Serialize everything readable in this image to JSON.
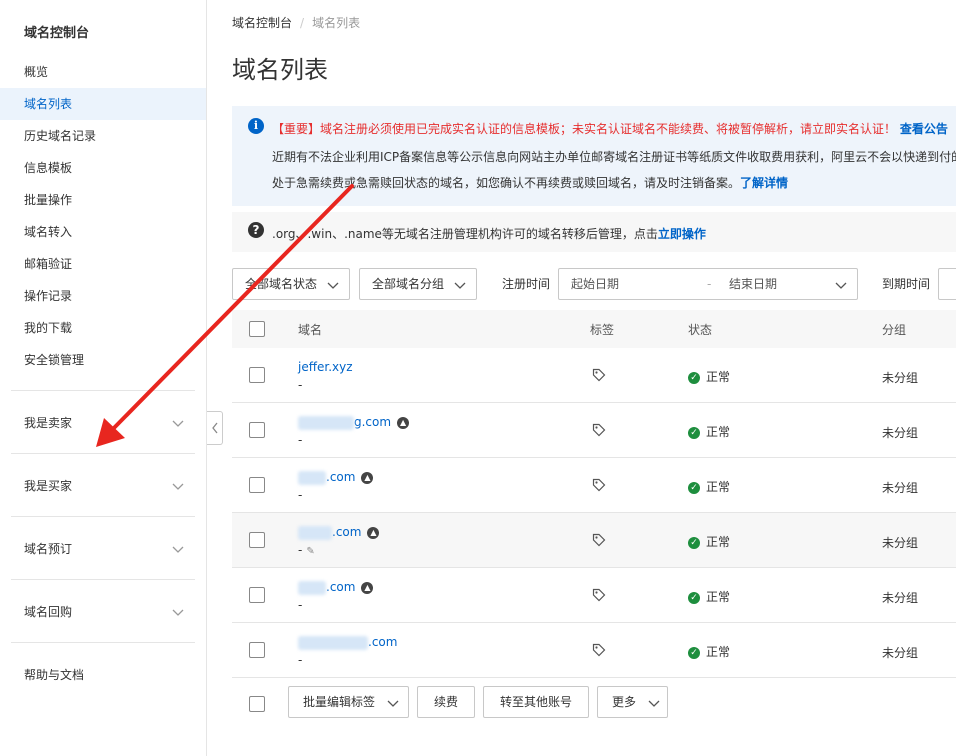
{
  "sidebar": {
    "title": "域名控制台",
    "items": [
      {
        "label": "概览",
        "active": false
      },
      {
        "label": "域名列表",
        "active": true
      },
      {
        "label": "历史域名记录",
        "active": false
      },
      {
        "label": "信息模板",
        "active": false
      },
      {
        "label": "批量操作",
        "active": false
      },
      {
        "label": "域名转入",
        "active": false
      },
      {
        "label": "邮箱验证",
        "active": false
      },
      {
        "label": "操作记录",
        "active": false
      },
      {
        "label": "我的下载",
        "active": false
      },
      {
        "label": "安全锁管理",
        "active": false
      }
    ],
    "groups": [
      {
        "label": "我是卖家"
      },
      {
        "label": "我是买家"
      },
      {
        "label": "域名预订"
      },
      {
        "label": "域名回购"
      }
    ],
    "help": "帮助与文档"
  },
  "breadcrumb": {
    "root": "域名控制台",
    "sep": "/",
    "current": "域名列表"
  },
  "page_title": "域名列表",
  "notice": {
    "important": "【重要】域名注册必须使用已完成实名认证的信息模板；未实名认证域名不能续费、将被暂停解析，请立即实名认证！",
    "important_link": "查看公告",
    "line2": "近期有不法企业利用ICP备案信息等公示信息向网站主办单位邮寄域名注册证书等纸质文件收取费用获利，阿里云不会以快递到付的",
    "line3": "处于急需续费或急需赎回状态的域名，如您确认不再续费或赎回域名，请及时注销备案。",
    "line3_link": "了解详情"
  },
  "tip": {
    "text": ".org、.win、.name等无域名注册管理机构许可的域名转移后管理，点击",
    "link": "立即操作"
  },
  "filters": {
    "status": "全部域名状态",
    "group": "全部域名分组",
    "reg_time_label": "注册时间",
    "start_placeholder": "起始日期",
    "range_sep": "-",
    "end_placeholder": "结束日期",
    "expire_label": "到期时间"
  },
  "table": {
    "headers": {
      "domain": "域名",
      "tag": "标签",
      "status": "状态",
      "group": "分组"
    },
    "rows": [
      {
        "domain": "jeffer.xyz",
        "sub": "-",
        "status": "正常",
        "group": "未分组",
        "blur_w": 0,
        "badge": false,
        "edit": false
      },
      {
        "domain": "g.com",
        "sub": "-",
        "status": "正常",
        "group": "未分组",
        "blur_w": 56,
        "badge": true,
        "edit": false
      },
      {
        "domain": ".com",
        "sub": "-",
        "status": "正常",
        "group": "未分组",
        "blur_w": 28,
        "badge": true,
        "edit": false
      },
      {
        "domain": ".com",
        "sub": "-",
        "status": "正常",
        "group": "未分组",
        "blur_w": 34,
        "badge": true,
        "edit": true
      },
      {
        "domain": ".com",
        "sub": "-",
        "status": "正常",
        "group": "未分组",
        "blur_w": 28,
        "badge": true,
        "edit": false
      },
      {
        "domain": ".com",
        "sub": "-",
        "status": "正常",
        "group": "未分组",
        "blur_w": 70,
        "badge": false,
        "edit": false
      }
    ]
  },
  "bottom_bar": {
    "batch_tag": "批量编辑标签",
    "renew": "续费",
    "transfer": "转至其他账号",
    "more": "更多"
  },
  "colors": {
    "accent": "#0064c8",
    "danger": "#e62e2e",
    "success": "#1e8e3e",
    "annotation": "#e8261f"
  }
}
